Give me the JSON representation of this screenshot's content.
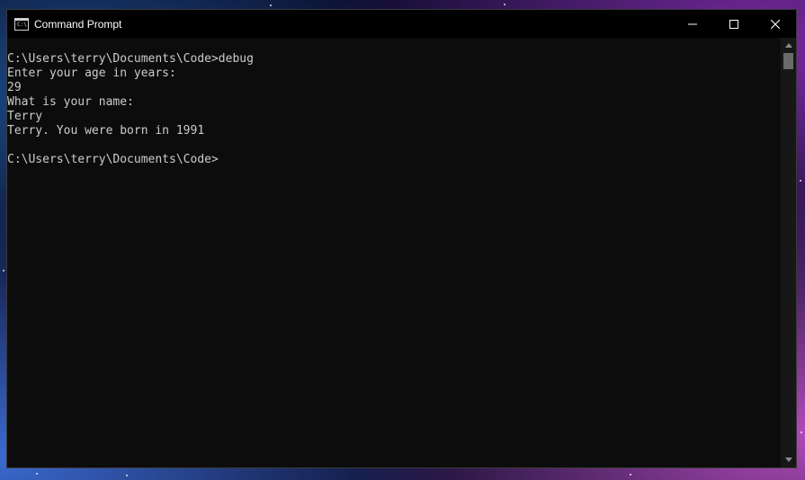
{
  "window": {
    "title": "Command Prompt",
    "icon": "cmd-icon",
    "icon_text": "C:\\"
  },
  "controls": {
    "minimize_icon": "minimize-icon",
    "maximize_icon": "maximize-icon",
    "close_icon": "close-icon"
  },
  "console": {
    "lines": [
      "C:\\Users\\terry\\Documents\\Code>debug",
      "Enter your age in years:",
      "29",
      "What is your name:",
      "Terry",
      "Terry. You were born in 1991",
      "",
      "C:\\Users\\terry\\Documents\\Code>"
    ]
  },
  "colors": {
    "console_bg": "#0c0c0c",
    "console_text": "#cccccc",
    "titlebar_bg": "#000000"
  }
}
